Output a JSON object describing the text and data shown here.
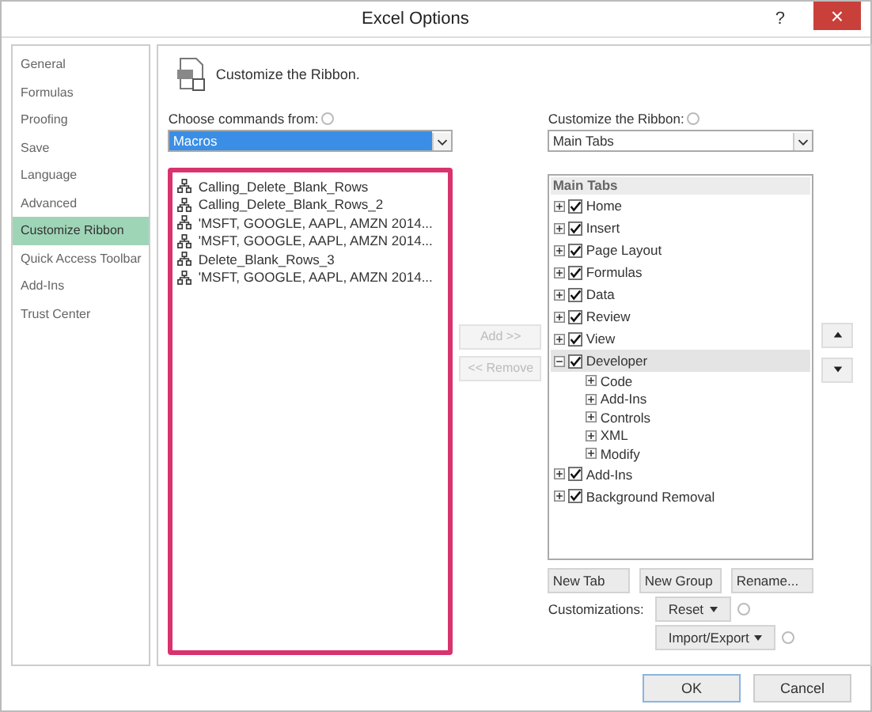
{
  "window": {
    "title": "Excel Options",
    "help": "?",
    "close": "×"
  },
  "sidebar": {
    "items": [
      {
        "label": "General",
        "selected": false
      },
      {
        "label": "Formulas",
        "selected": false
      },
      {
        "label": "Proofing",
        "selected": false
      },
      {
        "label": "Save",
        "selected": false
      },
      {
        "label": "Language",
        "selected": false
      },
      {
        "label": "Advanced",
        "selected": false
      },
      {
        "label": "Customize Ribbon",
        "selected": true
      },
      {
        "label": "Quick Access Toolbar",
        "selected": false
      },
      {
        "label": "Add-Ins",
        "selected": false
      },
      {
        "label": "Trust Center",
        "selected": false
      }
    ]
  },
  "header": {
    "title": "Customize the Ribbon."
  },
  "commands": {
    "label": "Choose commands from:",
    "value": "Macros",
    "items": [
      {
        "label": "Calling_Delete_Blank_Rows"
      },
      {
        "label": "Calling_Delete_Blank_Rows_2"
      },
      {
        "label": "'MSFT, GOOGLE, AAPL, AMZN 2014..."
      },
      {
        "label": "'MSFT, GOOGLE, AAPL, AMZN 2014..."
      },
      {
        "label": "Delete_Blank_Rows_3"
      },
      {
        "label": "'MSFT, GOOGLE, AAPL, AMZN 2014..."
      }
    ]
  },
  "middle_buttons": [
    {
      "label": "Add >>",
      "disabled": true
    },
    {
      "label": "<< Remove",
      "disabled": true
    }
  ],
  "ribbon": {
    "label": "Customize the Ribbon:",
    "value": "Main Tabs",
    "tree_header": "Main Tabs",
    "items": [
      {
        "label": "Home",
        "checked": true,
        "expanded": false,
        "selected": false
      },
      {
        "label": "Insert",
        "checked": true,
        "expanded": false,
        "selected": false
      },
      {
        "label": "Page Layout",
        "checked": true,
        "expanded": false,
        "selected": false
      },
      {
        "label": "Formulas",
        "checked": true,
        "expanded": false,
        "selected": false
      },
      {
        "label": "Data",
        "checked": true,
        "expanded": false,
        "selected": false
      },
      {
        "label": "Review",
        "checked": true,
        "expanded": false,
        "selected": false
      },
      {
        "label": "View",
        "checked": true,
        "expanded": false,
        "selected": false
      },
      {
        "label": "Developer",
        "checked": true,
        "expanded": true,
        "selected": true,
        "children": [
          {
            "label": "Code",
            "expanded": false
          },
          {
            "label": "Add-Ins",
            "expanded": false
          },
          {
            "label": "Controls",
            "expanded": false
          },
          {
            "label": "XML",
            "expanded": false
          },
          {
            "label": "Modify",
            "expanded": false
          }
        ]
      },
      {
        "label": "Add-Ins",
        "checked": true,
        "expanded": false,
        "selected": false
      },
      {
        "label": "Background Removal",
        "checked": true,
        "expanded": false,
        "selected": false
      }
    ],
    "buttons": [
      "New Tab",
      "New Group",
      "Rename..."
    ],
    "customizations_label": "Customizations:",
    "reset": "Reset",
    "import_export": "Import/Export"
  },
  "footer": {
    "buttons": [
      "OK",
      "Cancel"
    ]
  }
}
